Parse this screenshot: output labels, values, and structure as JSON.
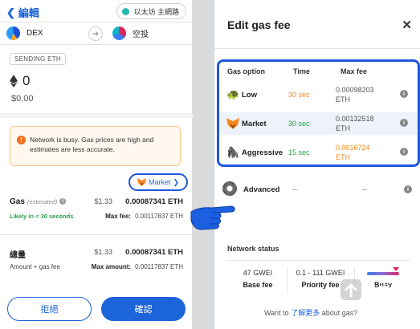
{
  "left": {
    "back_label": "編輯",
    "network": "以太坊 主網路",
    "from_account": "DEX",
    "to_account": "空投",
    "tx_type": "SENDING ETH",
    "amount": "0",
    "amount_usd": "$0.00",
    "warning": "Network is busy. Gas prices are high and estimates are less accurate.",
    "market_label": "Market",
    "gas": {
      "label": "Gas",
      "estimated": "(estimated)",
      "usd": "$1.33",
      "eth": "0.00087341 ETH",
      "likely": "Likely in < 30 seconds",
      "max_fee_label": "Max fee:",
      "max_fee_value": "0.00117837 ETH"
    },
    "total": {
      "label": "總量",
      "usd": "$1.33",
      "eth": "0.00087341 ETH",
      "sub": "Amount + gas fee",
      "max_amount_label": "Max amount:",
      "max_amount_value": "0.00117837 ETH"
    },
    "reject_label": "拒絕",
    "confirm_label": "確認"
  },
  "right": {
    "title": "Edit gas fee",
    "close": "✕",
    "headers": {
      "option": "Gas option",
      "time": "Time",
      "max_fee": "Max fee"
    },
    "options": [
      {
        "name": "Low",
        "time": "30 sec",
        "fee_line1": "0.00098203",
        "fee_line2": "ETH",
        "icon": "turtle-icon",
        "time_color": "#f08a1c",
        "fee_color": "#555555"
      },
      {
        "name": "Market",
        "time": "30 sec",
        "fee_line1": "0.00132518",
        "fee_line2": "ETH",
        "icon": "fox-icon",
        "time_color": "#26a14a",
        "fee_color": "#555555"
      },
      {
        "name": "Aggressive",
        "time": "15 sec",
        "fee_line1": "0.0016724",
        "fee_line2": "ETH",
        "icon": "gorilla-icon",
        "time_color": "#26a14a",
        "fee_color": "#f08a1c"
      }
    ],
    "advanced": {
      "name": "Advanced",
      "time": "--",
      "fee": "--"
    },
    "network_status": {
      "label": "Network status",
      "base_fee_value": "47 GWEI",
      "base_fee_label": "Base fee",
      "priority_value": "0.1 - 111 GWEI",
      "priority_label": "Priority fee",
      "busy_label": "Busy"
    },
    "learn_prefix": "Want to ",
    "learn_link": "了解更多",
    "learn_suffix": " about gas?"
  },
  "watermark": {
    "text": "路由器",
    "url": "luyouqi.com"
  },
  "colors": {
    "accent": "#1c64d9",
    "highlight": "#1f57d6",
    "green": "#26a14a",
    "orange": "#f08a1c"
  }
}
